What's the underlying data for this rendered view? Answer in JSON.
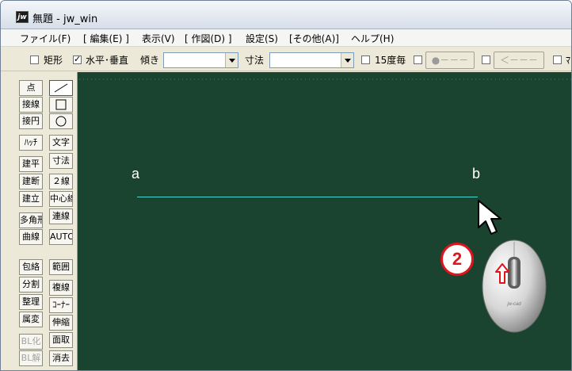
{
  "window": {
    "title": "無題 - jw_win",
    "app_icon_text": "jw"
  },
  "menu": [
    {
      "label": "ファイル(F)"
    },
    {
      "label": "[ 編集(E) ]"
    },
    {
      "label": "表示(V)"
    },
    {
      "label": "[ 作図(D) ]"
    },
    {
      "label": "設定(S)"
    },
    {
      "label": "[その他(A)]"
    },
    {
      "label": "ヘルプ(H)"
    }
  ],
  "toolbar": {
    "rect_label": "矩形",
    "rect_checked": false,
    "hv_label": "水平･垂直",
    "hv_checked": true,
    "angle_label": "傾き",
    "angle_value": "",
    "dim_label": "寸法",
    "dim_value": "",
    "deg15_label": "15度毎",
    "deg15_checked": false,
    "btn_dot_label": "●－－－",
    "btn_arrow_label": "＜－－－",
    "trailing_checkbox_label": "ﾏ"
  },
  "palette": {
    "left": [
      "点",
      "接線",
      "接円",
      "ﾊｯﾁ",
      "建平",
      "建断",
      "建立",
      "多角形",
      "曲線",
      "包絡",
      "分割",
      "整理",
      "属変",
      "BL化",
      "BL解"
    ],
    "right": [
      "文字",
      "寸法",
      "２線",
      "中心線",
      "連線",
      "AUTO",
      "範囲",
      "複線",
      "ｺｰﾅｰ",
      "伸縮",
      "面取",
      "消去"
    ],
    "right_icons": [
      "line-tool-icon",
      "rectangle-tool-icon",
      "circle-tool-icon"
    ]
  },
  "canvas": {
    "point_a_label": "a",
    "point_b_label": "b",
    "line_color": "#49d6cf",
    "background_color": "#1b4430"
  },
  "annotation": {
    "step_number": "2",
    "mouse_brand": "jw-cad",
    "accent_color": "#e0141c"
  }
}
